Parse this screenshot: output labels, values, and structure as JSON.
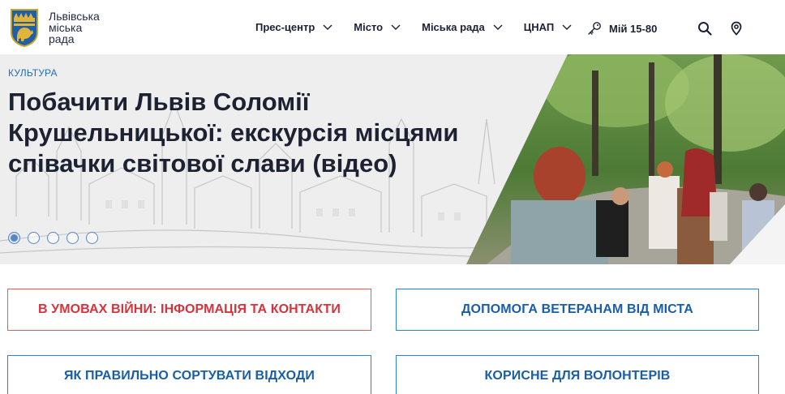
{
  "logo": {
    "line1": "Львівська",
    "line2": "міська",
    "line3": "рада"
  },
  "nav": {
    "items": [
      {
        "label": "Прес-центр"
      },
      {
        "label": "Місто"
      },
      {
        "label": "Міська рада"
      },
      {
        "label": "ЦНАП"
      }
    ],
    "hotline": "Мій 15-80"
  },
  "hero": {
    "category": "КУЛЬТУРА",
    "title": "Побачити Львів Соломії Крушельницької: екскурсія місцями співачки світової слави (відео)",
    "slides_total": 5,
    "active_slide": 1
  },
  "quick_links": [
    {
      "label": "В УМОВАХ ВІЙНИ: ІНФОРМАЦІЯ ТА КОНТАКТИ",
      "style": "red"
    },
    {
      "label": "ДОПОМОГА ВЕТЕРАНАМ ВІД МІСТА",
      "style": "blue"
    },
    {
      "label": "ЯК ПРАВИЛЬНО СОРТУВАТИ ВІДХОДИ",
      "style": "blue"
    },
    {
      "label": "КОРИСНЕ ДЛЯ ВОЛОНТЕРІВ",
      "style": "blue"
    }
  ],
  "colors": {
    "accent_blue": "#1d6fb8",
    "link_red": "#d8323a",
    "heading": "#1c2232"
  },
  "icons": [
    "lviv-coat-of-arms-icon",
    "chevron-down-icon",
    "key-icon",
    "search-icon",
    "location-pin-icon"
  ]
}
